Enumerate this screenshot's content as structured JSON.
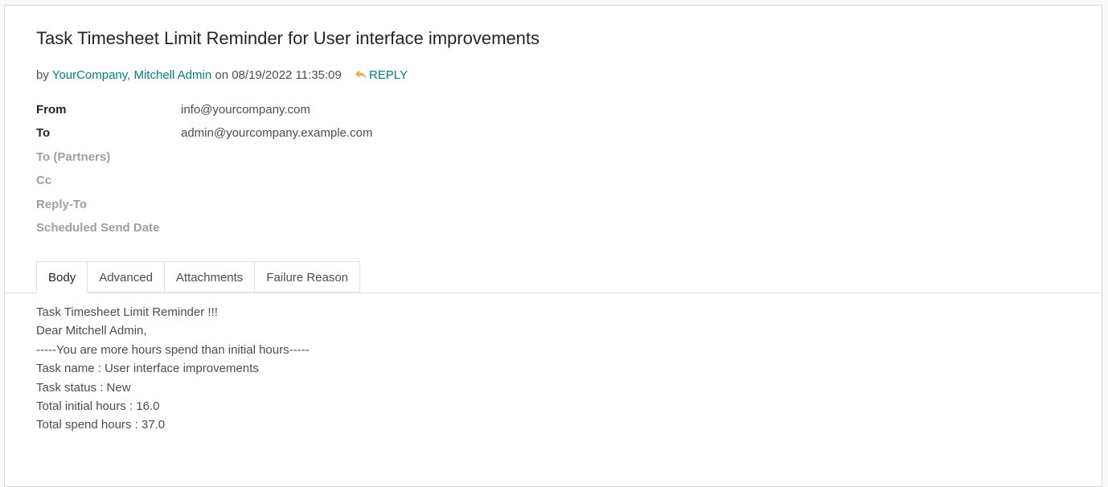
{
  "message": {
    "title": "Task Timesheet Limit Reminder for User interface improvements",
    "byline": {
      "prefix": "by",
      "author": "YourCompany, Mitchell Admin",
      "date_prefix": "on 08/19/2022 11:35:09",
      "reply_label": "REPLY"
    },
    "fields": [
      {
        "label": "From",
        "value": "info@yourcompany.com",
        "muted": false
      },
      {
        "label": "To",
        "value": "admin@yourcompany.example.com",
        "muted": false
      },
      {
        "label": "To (Partners)",
        "value": "",
        "muted": true
      },
      {
        "label": "Cc",
        "value": "",
        "muted": true
      },
      {
        "label": "Reply-To",
        "value": "",
        "muted": true
      },
      {
        "label": "Scheduled Send Date",
        "value": "",
        "muted": true
      }
    ],
    "tabs": [
      {
        "label": "Body",
        "active": true
      },
      {
        "label": "Advanced",
        "active": false
      },
      {
        "label": "Attachments",
        "active": false
      },
      {
        "label": "Failure Reason",
        "active": false
      }
    ],
    "body_lines": [
      "Task Timesheet Limit Reminder !!!",
      "Dear Mitchell Admin,",
      "-----You are more hours spend than initial hours-----",
      "Task name : User interface improvements",
      "Task status : New",
      "Total initial hours : 16.0",
      "Total spend hours : 37.0"
    ]
  },
  "colors": {
    "link": "#017e84",
    "reply_icon": "#f0ad4e"
  }
}
